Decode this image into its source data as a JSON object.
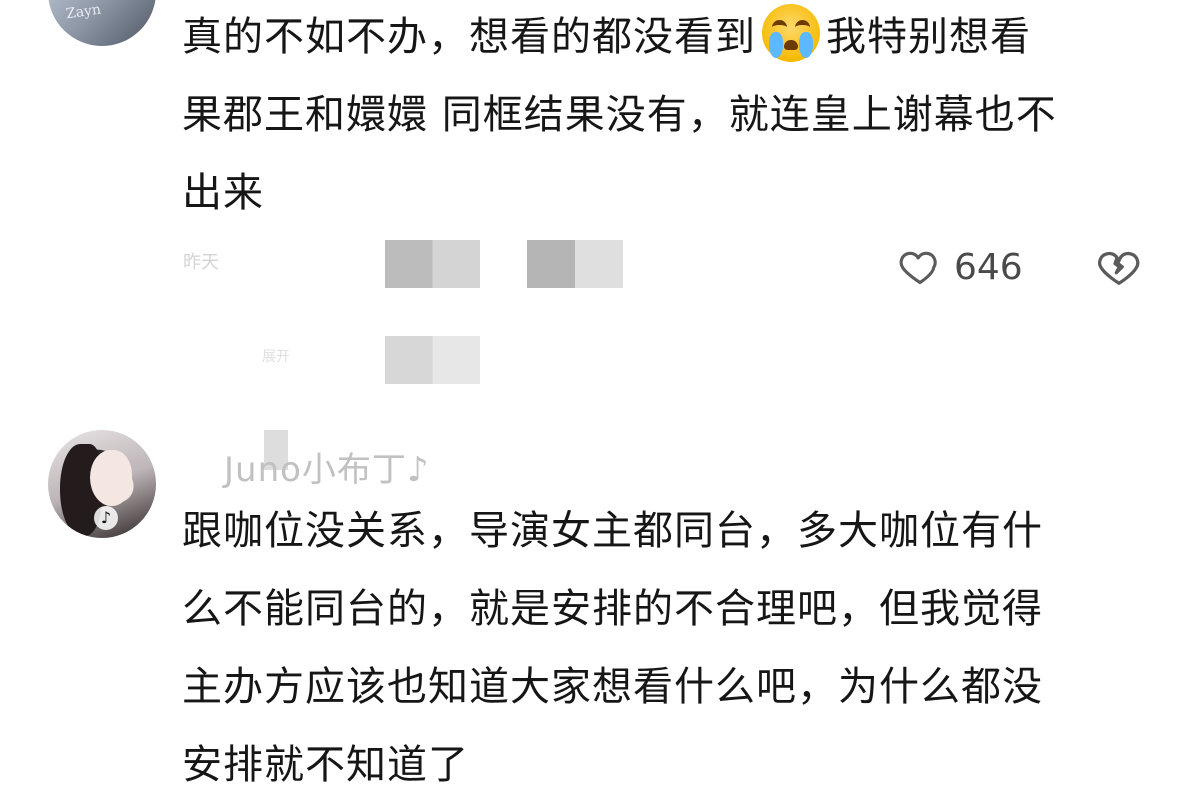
{
  "comments": [
    {
      "lines": [
        "真的不如不办，想看的都没看到",
        "我特别想看",
        "果郡王和嬛嬛 同框结果没有，就连皇上谢幕也不",
        "出来"
      ],
      "emoji": "crying-face-icon",
      "likes": "646",
      "meta_left": "昨天",
      "meta_second": "展开"
    },
    {
      "username": "Juno小布丁♪",
      "lines": [
        "跟咖位没关系，导演女主都同台，多大咖位有什",
        "么不能同台的，就是安排的不合理吧，但我觉得",
        "主办方应该也知道大家想看什么吧，为什么都没",
        "安排就不知道了"
      ]
    }
  ],
  "icons": {
    "like": "heart-outline-icon",
    "dislike": "broken-heart-icon",
    "platform": "tiktok-icon"
  },
  "colors": {
    "text": "#161616",
    "muted": "#4a4a4a",
    "placeholder": "#bcbcbc"
  }
}
